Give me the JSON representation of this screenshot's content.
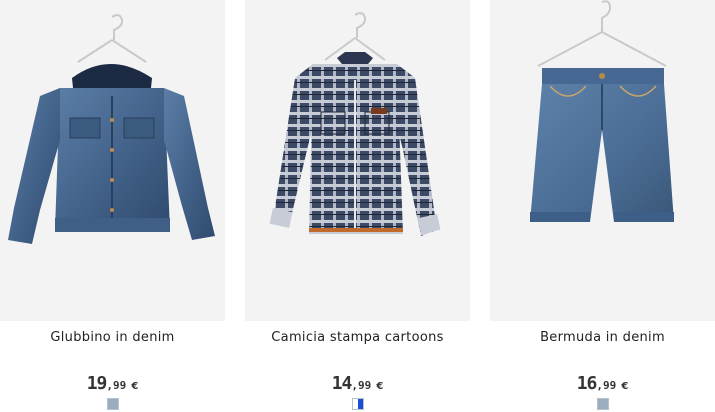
{
  "products": [
    {
      "name": "Glubbino in denim",
      "price_int": "19",
      "price_dec": ",99",
      "currency": "€",
      "swatch_colors": [
        "#9aaebf"
      ]
    },
    {
      "name": "Camicia stampa cartoons",
      "price_int": "14",
      "price_dec": ",99",
      "currency": "€",
      "swatch_colors": [
        "#ffffff",
        "#1a4ed8"
      ]
    },
    {
      "name": "Bermuda in denim",
      "price_int": "16",
      "price_dec": ",99",
      "currency": "€",
      "swatch_colors": [
        "#9aaebf"
      ]
    }
  ]
}
